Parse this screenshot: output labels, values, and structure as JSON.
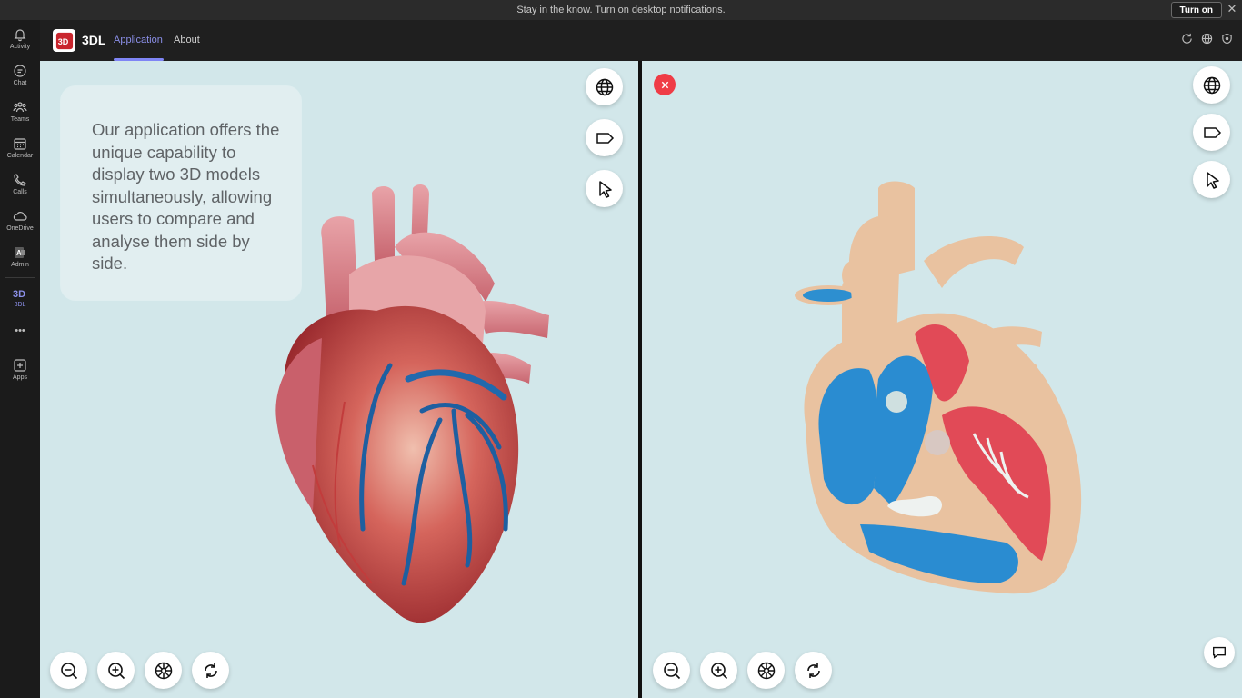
{
  "notification": {
    "text": "Stay in the know. Turn on desktop notifications.",
    "turn_on_label": "Turn on"
  },
  "rail": {
    "items": [
      {
        "label": "Activity"
      },
      {
        "label": "Chat"
      },
      {
        "label": "Teams"
      },
      {
        "label": "Calendar"
      },
      {
        "label": "Calls"
      },
      {
        "label": "OneDrive"
      },
      {
        "label": "Admin"
      },
      {
        "label": "3DL"
      },
      {
        "label": "Apps"
      }
    ],
    "more": "•••"
  },
  "app": {
    "name": "3DL",
    "logo_text": "3D",
    "tabs": [
      {
        "label": "Application"
      },
      {
        "label": "About"
      }
    ]
  },
  "info_card": {
    "text": "Our application offers the unique capability to display two 3D models simultaneously, allowing users to compare and analyse them side by side."
  },
  "colors": {
    "accent": "#7f85f5",
    "viewport_bg": "#d2e7ea",
    "close_red": "#ef3c46"
  }
}
